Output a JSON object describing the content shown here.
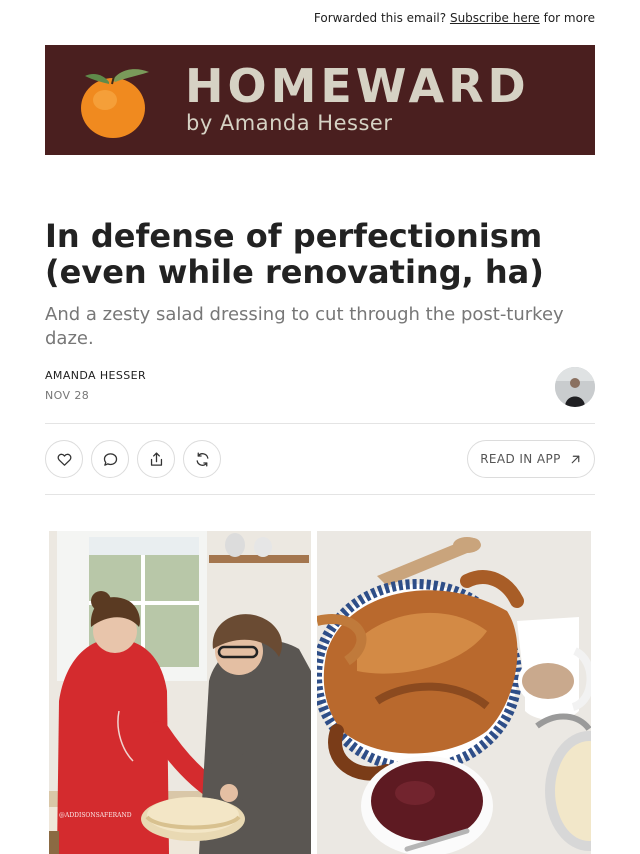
{
  "header": {
    "forward_prefix": "Forwarded this email?",
    "subscribe_link": "Subscribe here",
    "forward_suffix": "for more"
  },
  "banner": {
    "brand": "HOMEWARD",
    "byline": "by Amanda Hesser"
  },
  "post": {
    "title": "In defense of perfectionism (even while renovating, ha)",
    "subtitle": "And a zesty salad dressing to cut through the post-turkey daze.",
    "author": "AMANDA HESSER",
    "date": "NOV 28"
  },
  "actions": {
    "like_icon": "heart-icon",
    "comment_icon": "comment-icon",
    "share_icon": "share-icon",
    "restack_icon": "restack-icon",
    "read_in_app": "READ IN APP"
  },
  "images": {
    "left_watermark": "@ADDISONSAFERAND"
  },
  "colors": {
    "banner_bg": "#4a1f1f",
    "banner_text": "#d6d2c4",
    "subtitle": "#777777"
  }
}
